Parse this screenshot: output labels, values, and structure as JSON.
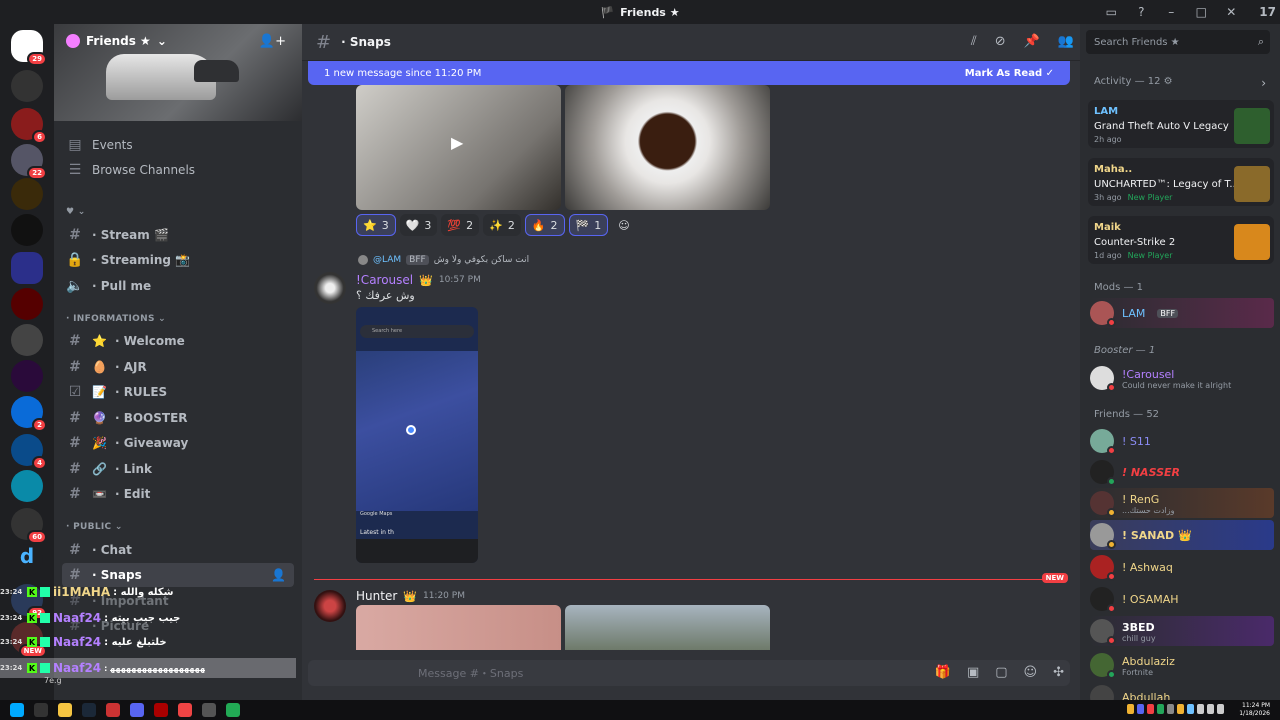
{
  "window": {
    "title": "Friends ★",
    "app_badge": "17"
  },
  "servers": {
    "badges": [
      "29",
      "6",
      "22",
      "2",
      "4",
      "60",
      "92"
    ],
    "new_tag": "NEW"
  },
  "sidebar": {
    "server_name": "Friends ★",
    "top_items": [
      {
        "label": "Events",
        "icon": "calendar-icon"
      },
      {
        "label": "Browse Channels",
        "icon": "list-icon"
      }
    ],
    "favorites": [
      {
        "label": "· Stream 🎬",
        "icon": "hash"
      },
      {
        "label": "· Streaming 📸",
        "icon": "lock"
      },
      {
        "label": "· Pull me",
        "icon": "speaker"
      }
    ],
    "cat_informations": "INFORMATIONS",
    "informations": [
      {
        "label": "· Welcome",
        "emoji": "⭐"
      },
      {
        "label": "· AJR",
        "emoji": "🥚"
      },
      {
        "label": "· RULES",
        "emoji": "📝"
      },
      {
        "label": "· BOOSTER",
        "emoji": "🔮"
      },
      {
        "label": "· Giveaway",
        "emoji": "🎉"
      },
      {
        "label": "· Link",
        "emoji": "🔗"
      },
      {
        "label": "· Edit",
        "emoji": "📼"
      }
    ],
    "cat_public": "PUBLIC",
    "public": [
      {
        "label": "· Chat"
      },
      {
        "label": "· Snaps"
      },
      {
        "label": "· Important"
      },
      {
        "label": "· Picture"
      }
    ]
  },
  "overlay_chat": [
    {
      "time": "23:24",
      "name": "ii1MAHA",
      "msg": ": شكله والله"
    },
    {
      "time": "23:24",
      "name": "Naaf24",
      "msg": ": جيب جيب بيته"
    },
    {
      "time": "23:24",
      "name": "Naaf24",
      "msg": ": خلتبلغ عليه"
    },
    {
      "time": "23:24",
      "name": "Naaf24",
      "msg": ": ﻬﻬﻬﻬﻬﻬﻬﻬﻬﻬﻬﻬﻬﻬﻬﻬﻬﻬ"
    }
  ],
  "overlay_small": "7e.g",
  "chat": {
    "channel": "· Snaps",
    "new_banner": "1 new message since 11:20 PM",
    "mark_read": "Mark As Read",
    "reactions": [
      {
        "emoji": "⭐",
        "count": "3",
        "me": true,
        "color": "#f0b232"
      },
      {
        "emoji": "🤍",
        "count": "3",
        "me": false,
        "color": "#ffffff"
      },
      {
        "emoji": "💯",
        "count": "2",
        "me": false,
        "color": "#f23f43"
      },
      {
        "emoji": "✨",
        "count": "2",
        "me": false,
        "color": "#f0b232"
      },
      {
        "emoji": "🔥",
        "count": "2",
        "me": true,
        "color": "#f0a030"
      },
      {
        "emoji": "🏁",
        "count": "1",
        "me": true,
        "color": "#ffffff"
      }
    ],
    "reply_user": "@LAM",
    "reply_tag": "BFF",
    "reply_text": "انت ساكن بكوفي ولا وش",
    "msg2_author": "!Carousel",
    "msg2_time": "10:57 PM",
    "msg2_text": "وش عرفك ؟",
    "map_search": "Search here",
    "map_bottom": "Latest in th",
    "map_brand": "Google Maps",
    "new_marker": "NEW",
    "msg3_author": "Hunter",
    "msg3_time": "11:20 PM",
    "composer_placeholder": "Message #・Snaps"
  },
  "members": {
    "search_placeholder": "Search Friends ★",
    "activity_head": "Activity — 12",
    "activities": [
      {
        "who": "LAM",
        "game": "Grand Theft Auto V Legacy",
        "meta": "2h ago",
        "np": "",
        "color": "#6ec1ff",
        "thumb": "#2e5f2e"
      },
      {
        "who": "Maha..",
        "game": "UNCHARTED™: Legacy of T...",
        "meta": "3h ago",
        "np": "New Player",
        "color": "#f0d68a",
        "thumb": "#8a6a2a"
      },
      {
        "who": "Maik",
        "game": "Counter-Strike 2",
        "meta": "1d ago",
        "np": "New Player",
        "color": "#f0d68a",
        "thumb": "#d8881c"
      }
    ],
    "mods_head": "Mods — 1",
    "mods": [
      {
        "name": "LAM",
        "tag": "BFF",
        "color": "#6ec1ff"
      }
    ],
    "booster_head": "Booster — 1",
    "boosters": [
      {
        "name": "!Carousel",
        "sub": "Could never make it alright",
        "color": "#b480ff"
      }
    ],
    "friends_head": "Friends — 52",
    "friends": [
      {
        "name": "! S11",
        "sub": "",
        "color": "#8b8cf5",
        "status": "#f23f43"
      },
      {
        "name": "! NASSER",
        "sub": "",
        "color": "#f23f43",
        "status": "#23a55a"
      },
      {
        "name": "! RenG",
        "sub": "...وزادت حستك",
        "color": "#f0d68a",
        "status": "#f0b232"
      },
      {
        "name": "! SANAD 👑",
        "sub": "",
        "color": "#f0d68a",
        "status": "#f0b232"
      },
      {
        "name": "! Ashwaq",
        "sub": "",
        "color": "#f0d68a",
        "status": "#f23f43"
      },
      {
        "name": "! OSAMAH",
        "sub": "",
        "color": "#f0d68a",
        "status": "#f23f43"
      },
      {
        "name": "3BED",
        "sub": "chill guy",
        "color": "#ffffff",
        "status": "#f23f43"
      },
      {
        "name": "Abdulaziz",
        "sub": "Fortnite",
        "color": "#f0d68a",
        "status": "#23a55a"
      },
      {
        "name": "Abdullah",
        "sub": "",
        "color": "#f0d68a",
        "status": "#f23f43"
      }
    ]
  },
  "taskbar": {
    "time": "11:24 PM",
    "date": "1/18/2026"
  }
}
